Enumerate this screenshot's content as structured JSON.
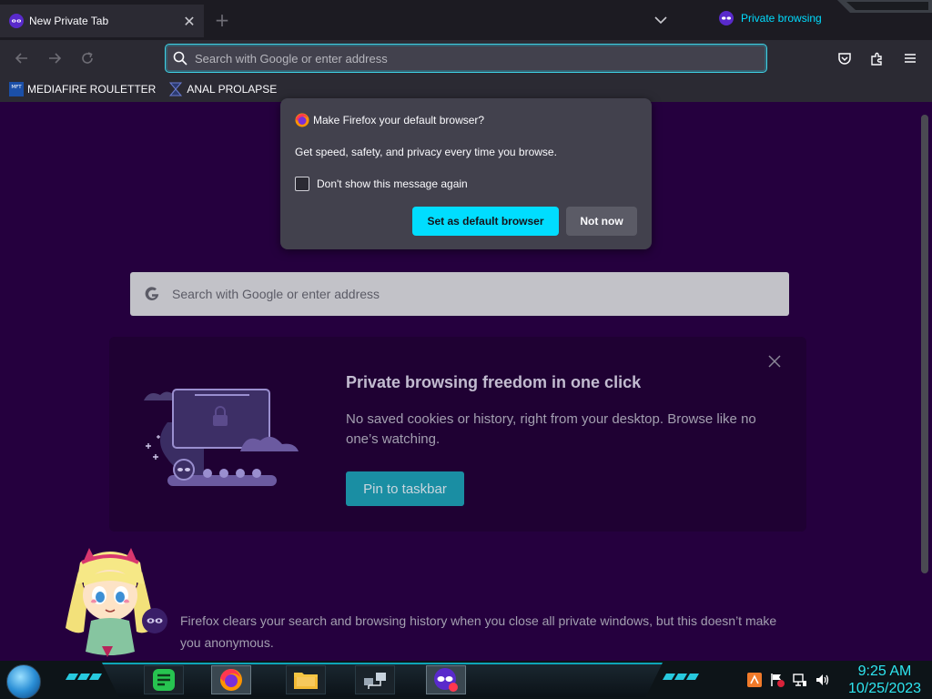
{
  "tab": {
    "title": "New Private Tab",
    "close": "✕",
    "new": "+"
  },
  "private_indicator": {
    "label": "Private browsing"
  },
  "urlbar": {
    "placeholder": "Search with Google or enter address"
  },
  "bookmarks": [
    {
      "label": "MEDIAFIRE ROULETTER",
      "icon_text": "MFT"
    },
    {
      "label": "ANAL PROLAPSE"
    }
  ],
  "popup": {
    "title": "Make Firefox your default browser?",
    "message": "Get speed, safety, and privacy every time you browse.",
    "checkbox_label": "Don't show this message again",
    "primary_button": "Set as default browser",
    "secondary_button": "Not now"
  },
  "main_search": {
    "placeholder": "Search with Google or enter address"
  },
  "promo": {
    "title": "Private browsing freedom in one click",
    "description": "No saved cookies or history, right from your desktop. Browse like no one’s watching.",
    "button": "Pin to taskbar"
  },
  "footer_note": "Firefox clears your search and browsing history when you close all private windows, but this doesn’t make you anonymous.",
  "taskbar": {
    "time": "9:25 AM",
    "date": "10/25/2023"
  },
  "colors": {
    "accent": "#00ddff",
    "private_bg": "#25003e",
    "toolbar": "#2b2a33"
  }
}
